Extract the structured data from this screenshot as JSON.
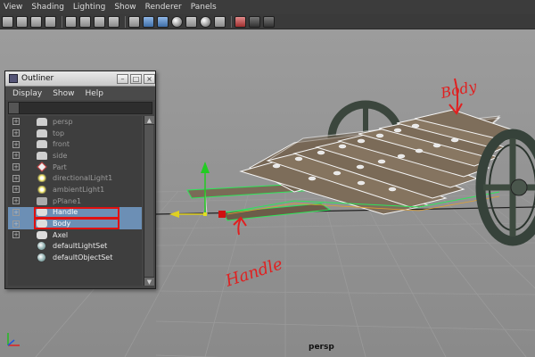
{
  "menubar": {
    "items": [
      "View",
      "Shading",
      "Lighting",
      "Show",
      "Renderer",
      "Panels"
    ]
  },
  "toolbar": {
    "icons": [
      "camera-icon",
      "bookmark-icon",
      "image-plane-icon",
      "grid-icon",
      "film-gate-icon",
      "resolution-gate-icon",
      "safe-action-icon",
      "wireframe-icon",
      "smooth-shade-icon",
      "textured-icon",
      "lights-icon",
      "shadows-icon",
      "isolate-icon",
      "xray-icon",
      "default-light-icon",
      "hud-icon",
      "render-icon"
    ]
  },
  "viewport": {
    "camera_label": "persp",
    "grid_color": "#9a9a9a",
    "background_color": "#8f8f8f",
    "highlight_color": "#ffffff",
    "wire_color": "#2ee65a"
  },
  "annotations": {
    "body": "Body",
    "handle": "Handle",
    "color": "#e02020"
  },
  "outliner": {
    "title": "Outliner",
    "menu": [
      "Display",
      "Show",
      "Help"
    ],
    "items": [
      {
        "label": "persp",
        "icon": "camera-icon",
        "state": "dim"
      },
      {
        "label": "top",
        "icon": "camera-icon",
        "state": "dim"
      },
      {
        "label": "front",
        "icon": "camera-icon",
        "state": "dim"
      },
      {
        "label": "side",
        "icon": "camera-icon",
        "state": "dim"
      },
      {
        "label": "Part",
        "icon": "part-icon",
        "state": "dim"
      },
      {
        "label": "directionalLight1",
        "icon": "light-icon",
        "state": "dim"
      },
      {
        "label": "ambientLight1",
        "icon": "light-icon",
        "state": "dim"
      },
      {
        "label": "pPlane1",
        "icon": "plane-icon",
        "state": "dim"
      },
      {
        "label": "Handle",
        "icon": "mesh-icon",
        "state": "selected"
      },
      {
        "label": "Body",
        "icon": "mesh-icon",
        "state": "selected"
      },
      {
        "label": "Axel",
        "icon": "mesh-icon",
        "state": "active"
      },
      {
        "label": "defaultLightSet",
        "icon": "set-icon",
        "state": "active"
      },
      {
        "label": "defaultObjectSet",
        "icon": "set-icon",
        "state": "active"
      }
    ],
    "selection_color": "#6c8fb5"
  }
}
